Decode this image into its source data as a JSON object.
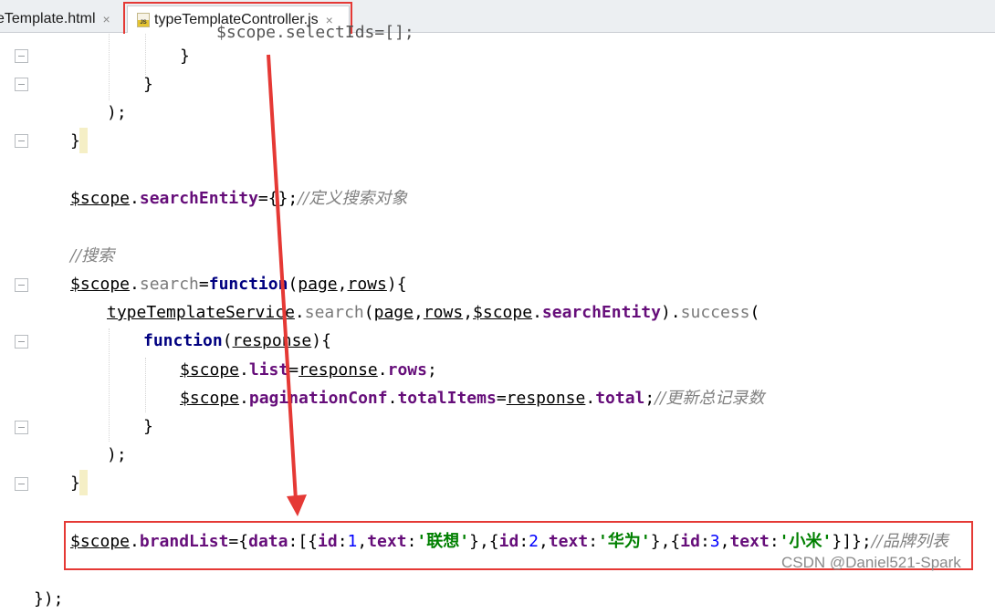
{
  "tabs": [
    {
      "label": "eTemplate.html",
      "active": false,
      "close": "×",
      "icon": "html-file-icon"
    },
    {
      "label": "typeTemplateController.js",
      "active": true,
      "close": "×",
      "icon": "js-file-icon",
      "icon_text": "JS"
    }
  ],
  "code": {
    "l0": "$scope.selectIds=[];",
    "l1": "}",
    "l2": "}",
    "l3": ");",
    "l4": "}",
    "l6": {
      "obj": "$scope",
      "dot": ".",
      "field": "searchEntity",
      "rest": "={};",
      "comment": "//定义搜索对象"
    },
    "l8": {
      "comment": "//搜索"
    },
    "l9": {
      "obj": "$scope",
      "dot": ".",
      "method": "search",
      "eq": "=",
      "kw": "function",
      "p1": "page",
      "comma": ",",
      "p2": "rows",
      "rest": "){"
    },
    "l10": {
      "obj": "typeTemplateService",
      "dot": ".",
      "method": "search",
      "open": "(",
      "a1": "page",
      "c1": ",",
      "a2": "rows",
      "c2": ",",
      "a3": "$scope",
      "d2": ".",
      "f3": "searchEntity",
      "close": ")",
      "d3": ".",
      "method2": "success",
      "rest": "("
    },
    "l11": {
      "kw": "function",
      "open": "(",
      "p": "response",
      "rest": "){"
    },
    "l12": {
      "obj": "$scope",
      "dot": ".",
      "field": "list",
      "eq": "=",
      "v": "response",
      "d2": ".",
      "f2": "rows",
      "rest": ";"
    },
    "l13": {
      "obj": "$scope",
      "dot": ".",
      "field": "paginationConf",
      "d2": ".",
      "f2": "totalItems",
      "eq": "=",
      "v": "response",
      "d3": ".",
      "f3": "total",
      "rest": ";",
      "comment": "//更新总记录数"
    },
    "l14": "}",
    "l15": ");",
    "l16": "}",
    "l18": {
      "obj": "$scope",
      "dot": ".",
      "field": "brandList",
      "eq": "={",
      "data_key": "data",
      "colon": ":",
      "open": "[{",
      "items": [
        {
          "id_key": "id",
          "id": "1",
          "text_key": "text",
          "text": "'联想'"
        },
        {
          "id_key": "id",
          "id": "2",
          "text_key": "text",
          "text": "'华为'"
        },
        {
          "id_key": "id",
          "id": "3",
          "text_key": "text",
          "text": "'小米'"
        }
      ],
      "sep": "},{",
      "comma": ",",
      "end": "}]};",
      "comment": "//品牌列表"
    },
    "l20": "});"
  },
  "watermark": "CSDN @Daniel521-Spark",
  "colors": {
    "highlight": "#e53935",
    "keyword": "#000080",
    "field": "#660e7a",
    "string": "#008000",
    "number": "#0000ff",
    "comment": "#808080"
  }
}
